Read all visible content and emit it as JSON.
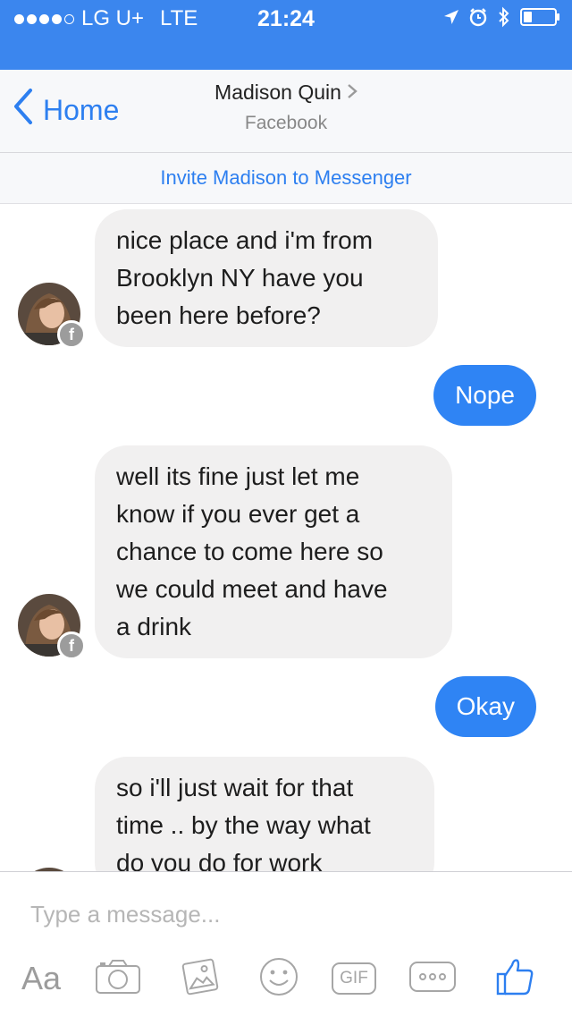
{
  "status_bar": {
    "carrier": "LG U+",
    "network": "LTE",
    "time": "21:24"
  },
  "nav": {
    "back_label": "Home",
    "title": "Madison Quin",
    "subtitle": "Facebook"
  },
  "invite_banner": {
    "text": "Invite Madison to Messenger"
  },
  "messages": [
    {
      "from": "Madison Quin",
      "lines": [
        "nice place and i'm from",
        "Brooklyn NY have you",
        "been here before?"
      ]
    },
    {
      "from": "me",
      "text": "Nope"
    },
    {
      "from": "Madison Quin",
      "lines": [
        "well its fine just let me",
        "know if you ever get a",
        "chance to come here so",
        "we could meet and have",
        "a drink"
      ]
    },
    {
      "from": "me",
      "text": "Okay"
    },
    {
      "from": "Madison Quin",
      "lines": [
        "so i'll just wait for that",
        "time .. by the way what",
        "do you do for work"
      ]
    }
  ],
  "composer": {
    "placeholder": "Type a message...",
    "tools": {
      "text": "Aa",
      "gif": "GIF"
    }
  },
  "icons": {
    "back": "chevron-left-icon",
    "disclosure": "chevron-right-icon",
    "location": "location-arrow-icon",
    "alarm": "alarm-clock-icon",
    "bluetooth": "bluetooth-icon",
    "battery": "battery-icon",
    "camera": "camera-icon",
    "gallery": "photo-gallery-icon",
    "sticker": "smiley-icon",
    "more": "more-dots-icon",
    "like": "thumbs-up-icon",
    "facebook_badge": "facebook-badge-icon"
  },
  "colors": {
    "header_blue": "#3b86ee",
    "accent_blue": "#2d7ff0",
    "outgoing_bubble": "#2f84f4",
    "incoming_bubble": "#f1f0f0"
  }
}
